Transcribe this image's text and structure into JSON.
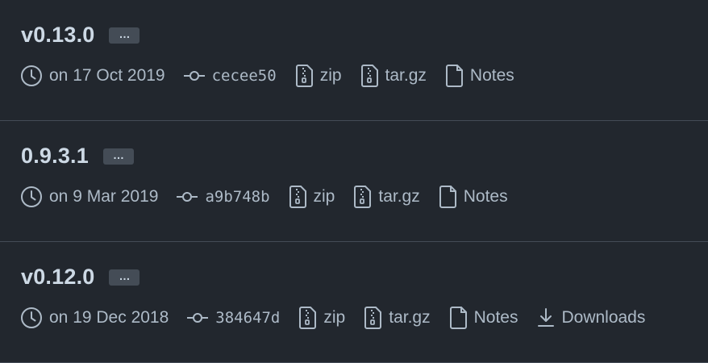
{
  "releases": [
    {
      "tag": "v0.13.0",
      "more_label": "…",
      "date": "on 17 Oct 2019",
      "commit": "cecee50",
      "zip_label": "zip",
      "targz_label": "tar.gz",
      "notes_label": "Notes"
    },
    {
      "tag": "0.9.3.1",
      "more_label": "…",
      "date": "on 9 Mar 2019",
      "commit": "a9b748b",
      "zip_label": "zip",
      "targz_label": "tar.gz",
      "notes_label": "Notes"
    },
    {
      "tag": "v0.12.0",
      "more_label": "…",
      "date": "on 19 Dec 2018",
      "commit": "384647d",
      "zip_label": "zip",
      "targz_label": "tar.gz",
      "notes_label": "Notes",
      "downloads_label": "Downloads"
    }
  ],
  "icons": {
    "date": "clock-icon",
    "commit": "git-commit-icon",
    "zip": "file-zip-icon",
    "targz": "file-zip-icon",
    "notes": "file-icon",
    "downloads": "download-icon"
  },
  "colors": {
    "background": "#22272e",
    "title": "#cdd9e5",
    "meta_text": "#adbac7",
    "divider": "#444c56",
    "more_button_bg": "#444c56"
  }
}
